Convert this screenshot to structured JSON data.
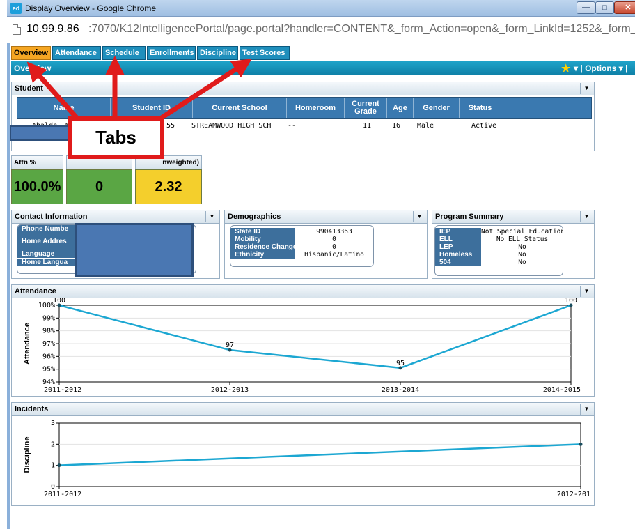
{
  "window": {
    "title": "Display Overview - Google Chrome",
    "app_icon": "ed",
    "url_host": "10.99.9.86",
    "url_path": ":7070/K12IntelligencePortal/page.portal?handler=CONTENT&_form_Action=open&_form_LinkId=1252&_form_Refresh=N&_"
  },
  "tabs": [
    "Overview",
    "Attendance",
    "Schedule",
    "Enrollments",
    "Discipline",
    "Test Scores"
  ],
  "active_tab": "Overview",
  "section_bar": {
    "label": "Overview",
    "options_label": "Options",
    "star_icon": "star-icon"
  },
  "student": {
    "title": "Student",
    "columns": [
      "Name",
      "Student ID",
      "Current School",
      "Homeroom",
      "Current Grade",
      "Age",
      "Gender",
      "Status"
    ],
    "row": {
      "name": "Abalde, M",
      "student_id": "55",
      "school": "STREAMWOOD HIGH SCH",
      "homeroom": "--",
      "grade": "11",
      "age": "16",
      "gender": "Male",
      "status": "Active"
    }
  },
  "kpis": [
    {
      "label": "Attn %",
      "value": "100.0%",
      "color": "#5aa644"
    },
    {
      "label": "",
      "value": "0",
      "color": "#5aa644"
    },
    {
      "label": "nweighted)",
      "value": "2.32",
      "color": "#f4cf2c"
    }
  ],
  "contact": {
    "title": "Contact Information",
    "rows": [
      {
        "key": "Phone Numbe",
        "value": ""
      },
      {
        "key": "Home Addres",
        "value": ""
      },
      {
        "key": "Language",
        "value": ""
      },
      {
        "key": "Home Langua",
        "value": ""
      }
    ]
  },
  "demographics": {
    "title": "Demographics",
    "rows": [
      {
        "key": "State ID",
        "value": "990413363"
      },
      {
        "key": "Mobility",
        "value": "0"
      },
      {
        "key": "Residence Changes",
        "value": "0"
      },
      {
        "key": "Ethnicity",
        "value": "Hispanic/Latino"
      }
    ]
  },
  "program": {
    "title": "Program Summary",
    "rows": [
      {
        "key": "IEP",
        "value": "Not Special Education"
      },
      {
        "key": "ELL",
        "value": "No ELL Status"
      },
      {
        "key": "LEP",
        "value": "No"
      },
      {
        "key": "Homeless",
        "value": "No"
      },
      {
        "key": "504",
        "value": "No"
      }
    ]
  },
  "attendance_chart": {
    "title": "Attendance"
  },
  "incidents_chart": {
    "title": "Incidents"
  },
  "annotation": {
    "label": "Tabs"
  },
  "chart_data": [
    {
      "type": "line",
      "title": "Attendance",
      "ylabel": "Attendance",
      "x": [
        "2011-2012",
        "2012-2013",
        "2013-2014",
        "2014-2015"
      ],
      "values": [
        100,
        96.5,
        95.1,
        100
      ],
      "data_labels": [
        "100",
        "97",
        "95",
        "100"
      ],
      "yticks": [
        "100%",
        "99%",
        "98%",
        "97%",
        "96%",
        "95%",
        "94%"
      ],
      "ylim": [
        94,
        100
      ],
      "color": "#1ca7d2"
    },
    {
      "type": "line",
      "title": "Incidents",
      "ylabel": "Discipline",
      "x": [
        "2011-2012",
        "2012-201"
      ],
      "values": [
        1,
        2
      ],
      "yticks": [
        "3",
        "2",
        "1",
        "0"
      ],
      "ylim": [
        0,
        3
      ],
      "color": "#1ca7d2"
    }
  ]
}
